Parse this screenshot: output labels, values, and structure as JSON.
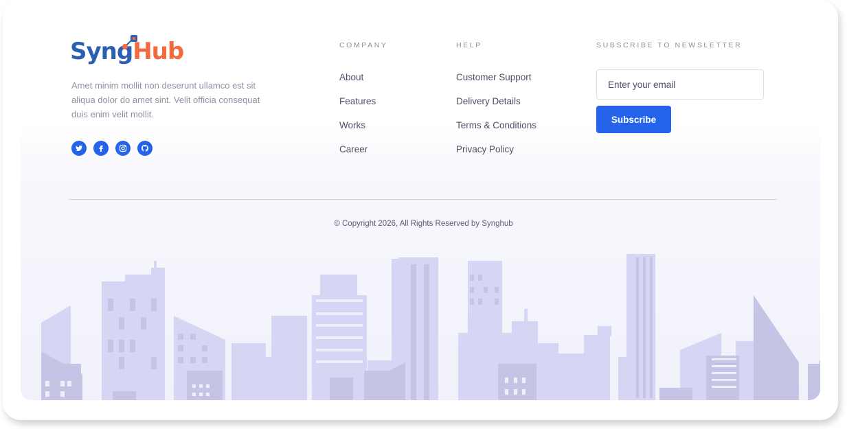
{
  "brand": {
    "logo_syng": "Syng",
    "logo_hub": "Hub",
    "description": "Amet minim mollit non deserunt ullamco est sit aliqua dolor do amet sint. Velit officia consequat duis enim velit mollit.",
    "socials": [
      {
        "icon": "twitter-icon"
      },
      {
        "icon": "facebook-icon"
      },
      {
        "icon": "instagram-icon"
      },
      {
        "icon": "github-icon"
      }
    ]
  },
  "company": {
    "title": "COMPANY",
    "links": [
      "About",
      "Features",
      "Works",
      "Career"
    ]
  },
  "help": {
    "title": "HELP",
    "links": [
      "Customer Support",
      "Delivery Details",
      "Terms & Conditions",
      "Privacy Policy"
    ]
  },
  "newsletter": {
    "title": "SUBSCRIBE TO NEWSLETTER",
    "placeholder": "Enter your email",
    "button_label": "Subscribe"
  },
  "footer": {
    "copyright": "© Copyright 2026, All Rights Reserved by Synghub"
  },
  "colors": {
    "accent": "#2563eb",
    "logo_blue": "#2a5fb1",
    "logo_orange": "#f26a3d",
    "skyline_light": "#d6d5f3",
    "skyline_dark": "#c6c4e4"
  }
}
